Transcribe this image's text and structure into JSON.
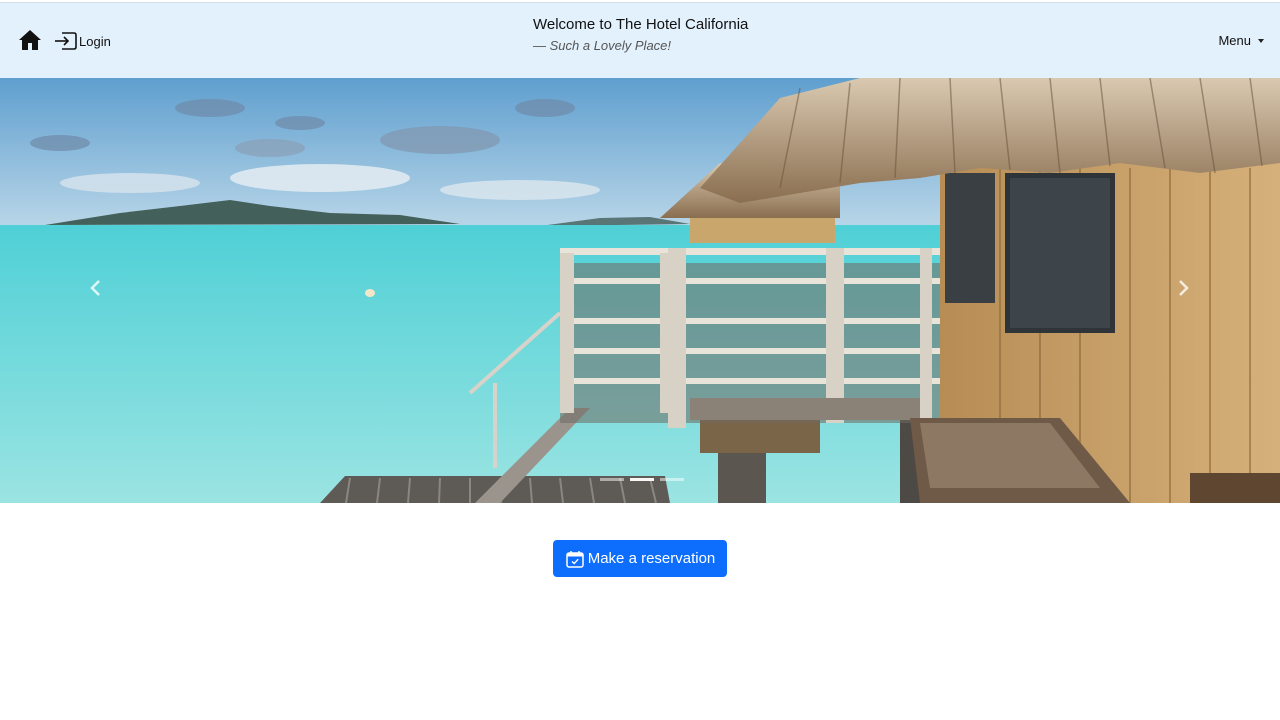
{
  "header": {
    "title": "Welcome to The Hotel California",
    "subtitle": "— Such a Lovely Place!",
    "login_label": "Login",
    "menu_label": "Menu",
    "home_icon": "house-icon",
    "login_icon": "box-arrow-in-right-icon"
  },
  "carousel": {
    "prev_icon": "chevron-left-icon",
    "next_icon": "chevron-right-icon",
    "slide_count": 3,
    "active_slide": 2
  },
  "cta": {
    "label": "Make a reservation",
    "icon": "calendar-check-icon",
    "color": "#0d6efd"
  },
  "colors": {
    "navbar_bg": "#e3f1fc",
    "sea": "#5ccfd0",
    "sky": "#7fb4d6"
  }
}
